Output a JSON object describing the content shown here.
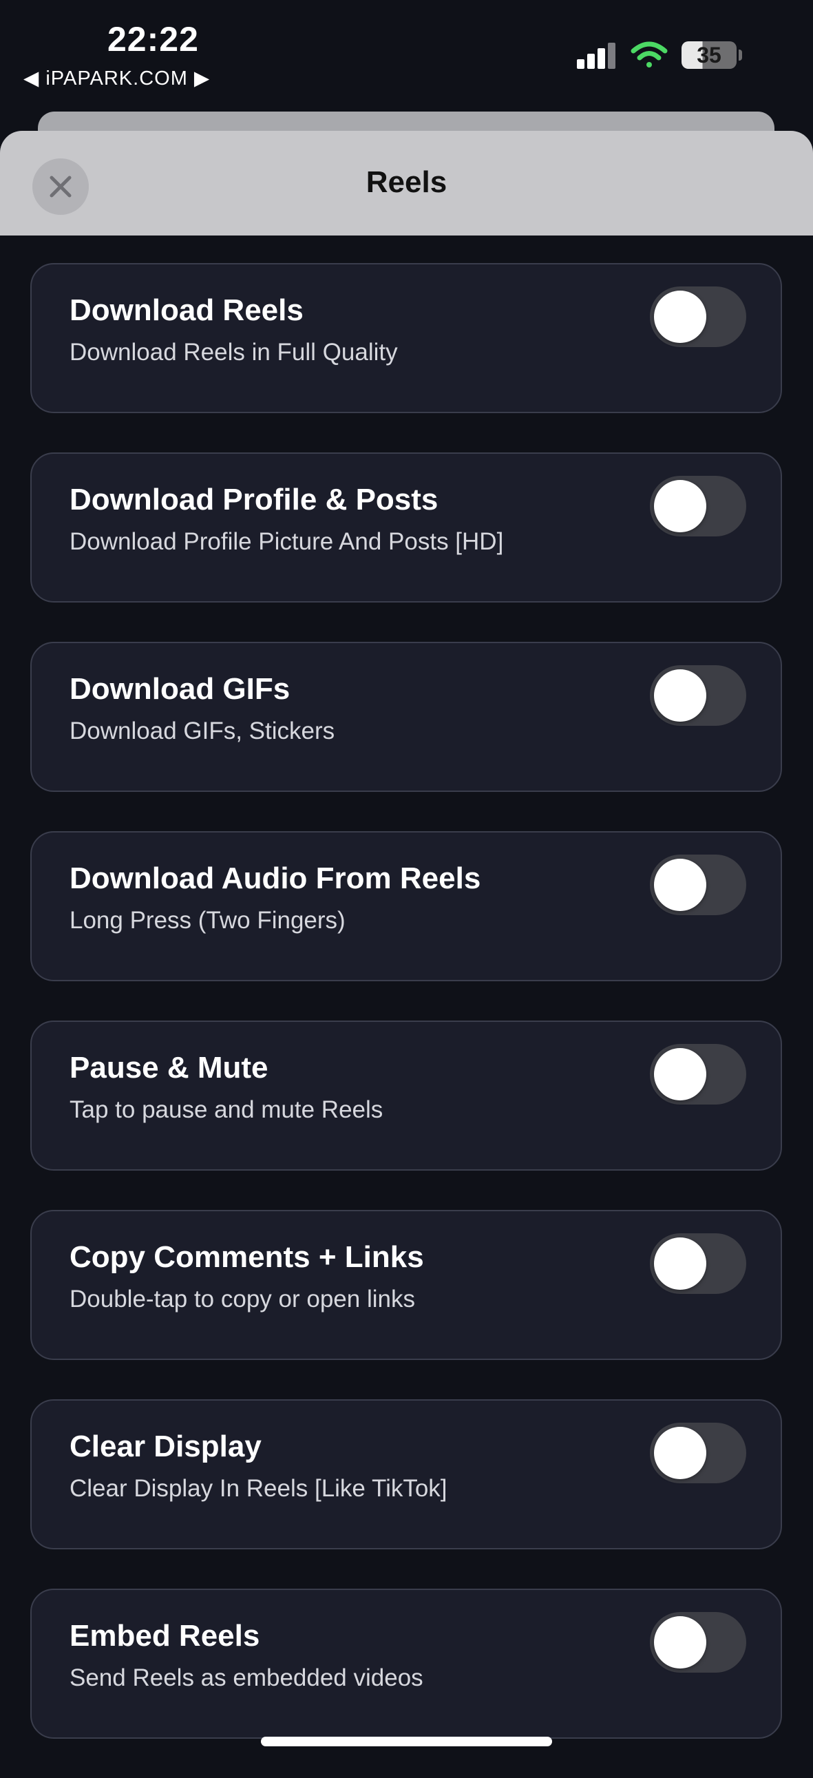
{
  "status_bar": {
    "time": "22:22",
    "carrier": "◀ iPAPARK.COM ▶",
    "battery": "35"
  },
  "header": {
    "title": "Reels"
  },
  "settings": [
    {
      "title": "Download Reels",
      "subtitle": "Download Reels in Full Quality",
      "enabled": false
    },
    {
      "title": "Download Profile & Posts",
      "subtitle": "Download Profile Picture And Posts [HD]",
      "enabled": false
    },
    {
      "title": "Download GIFs",
      "subtitle": "Download GIFs, Stickers",
      "enabled": false
    },
    {
      "title": "Download Audio From Reels",
      "subtitle": "Long Press (Two Fingers)",
      "enabled": false
    },
    {
      "title": "Pause & Mute",
      "subtitle": "Tap to pause and mute Reels",
      "enabled": false
    },
    {
      "title": "Copy Comments + Links",
      "subtitle": "Double-tap to copy or open links",
      "enabled": false
    },
    {
      "title": "Clear Display",
      "subtitle": "Clear Display In Reels [Like TikTok]",
      "enabled": false
    },
    {
      "title": "Embed Reels",
      "subtitle": "Send Reels as embedded videos",
      "enabled": false
    }
  ],
  "colors": {
    "background": "#0f1118",
    "card": "#1b1d2a",
    "card_border": "#3a3d4c",
    "toggle_off": "#3d3e45",
    "wifi": "#4cd964",
    "header": "#c7c7ca"
  },
  "icons": {
    "close": "close-icon",
    "signal": "cellular-signal-icon",
    "wifi": "wifi-icon",
    "battery": "battery-icon"
  }
}
